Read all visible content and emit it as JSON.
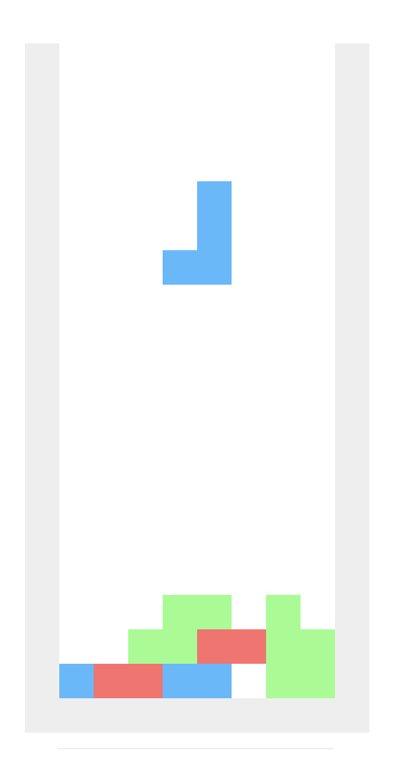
{
  "game": {
    "grid": {
      "cols": 8,
      "rows": 19
    },
    "colors": {
      "board_background": "#ffffff",
      "well_frame": "#eeeeee",
      "blue": "#6bb8f8",
      "red": "#ee7570",
      "green": "#aafb95"
    },
    "falling_piece": {
      "shape": "J",
      "color": "blue",
      "cells": [
        {
          "col": 4,
          "row": 4
        },
        {
          "col": 4,
          "row": 5
        },
        {
          "col": 3,
          "row": 6
        },
        {
          "col": 4,
          "row": 6
        }
      ]
    },
    "locked_cells": [
      {
        "col": 3,
        "row": 16,
        "color": "green"
      },
      {
        "col": 4,
        "row": 16,
        "color": "green"
      },
      {
        "col": 6,
        "row": 16,
        "color": "green"
      },
      {
        "col": 2,
        "row": 17,
        "color": "green"
      },
      {
        "col": 3,
        "row": 17,
        "color": "green"
      },
      {
        "col": 4,
        "row": 17,
        "color": "red"
      },
      {
        "col": 5,
        "row": 17,
        "color": "red"
      },
      {
        "col": 6,
        "row": 17,
        "color": "green"
      },
      {
        "col": 7,
        "row": 17,
        "color": "green"
      },
      {
        "col": 0,
        "row": 18,
        "color": "blue"
      },
      {
        "col": 1,
        "row": 18,
        "color": "red"
      },
      {
        "col": 2,
        "row": 18,
        "color": "red"
      },
      {
        "col": 3,
        "row": 18,
        "color": "blue"
      },
      {
        "col": 4,
        "row": 18,
        "color": "blue"
      },
      {
        "col": 6,
        "row": 18,
        "color": "green"
      },
      {
        "col": 7,
        "row": 18,
        "color": "green"
      }
    ]
  }
}
